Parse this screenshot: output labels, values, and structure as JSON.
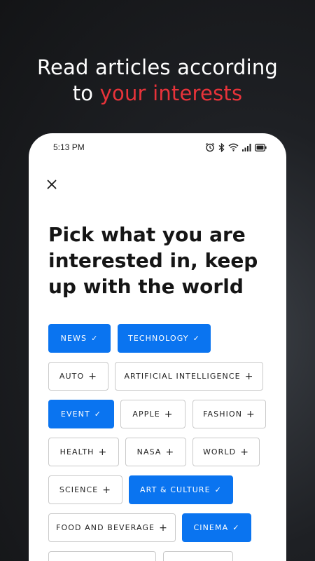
{
  "promo": {
    "headline_line1": "Read articles according",
    "headline_line2_prefix": "to ",
    "headline_line2_accent": "your interests",
    "accent_color": "#e8333a"
  },
  "status_bar": {
    "time": "5:13 PM",
    "icons": [
      "alarm-icon",
      "bluetooth-icon",
      "wifi-icon",
      "signal-icon",
      "battery-icon"
    ]
  },
  "screen": {
    "close_icon": "close-icon",
    "title": "Pick what you are interested in, keep up with the world",
    "selected_color": "#0a74f0",
    "chips": [
      {
        "label": "NEWS",
        "selected": true
      },
      {
        "label": "TECHNOLOGY",
        "selected": true
      },
      {
        "label": "AUTO",
        "selected": false
      },
      {
        "label": "ARTIFICIAL INTELLIGENCE",
        "selected": false
      },
      {
        "label": "EVENT",
        "selected": true
      },
      {
        "label": "APPLE",
        "selected": false
      },
      {
        "label": "FASHION",
        "selected": false
      },
      {
        "label": "HEALTH",
        "selected": false
      },
      {
        "label": "NASA",
        "selected": false
      },
      {
        "label": "WORLD",
        "selected": false
      },
      {
        "label": "SCIENCE",
        "selected": false
      },
      {
        "label": "ART & CULTURE",
        "selected": true
      },
      {
        "label": "FOOD AND BEVERAGE",
        "selected": false
      },
      {
        "label": "CINEMA",
        "selected": true
      }
    ],
    "mark_selected": "✓",
    "mark_unselected": "+"
  }
}
